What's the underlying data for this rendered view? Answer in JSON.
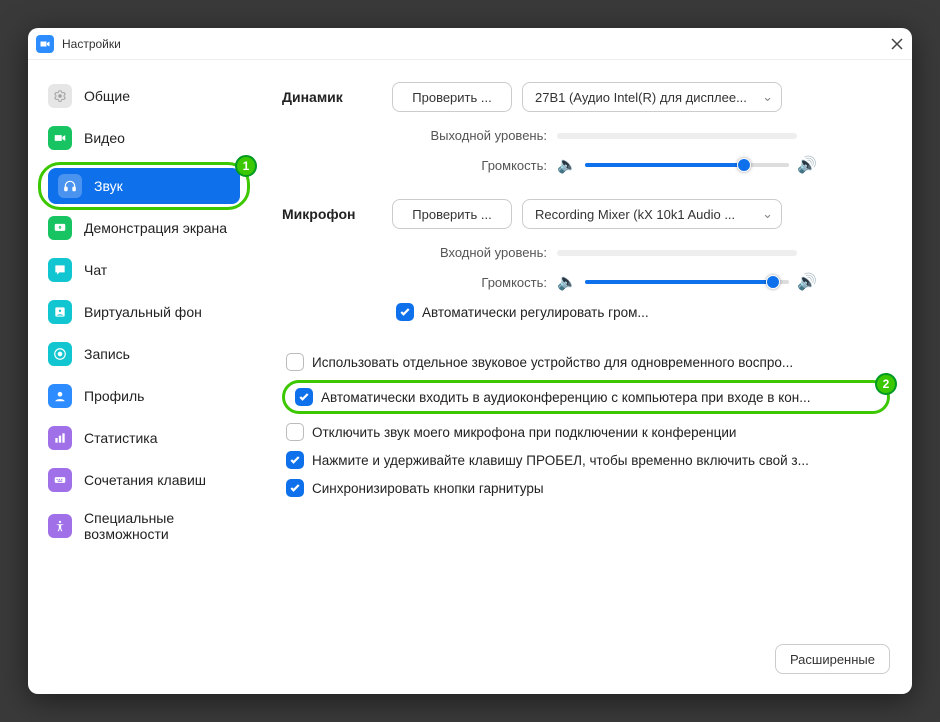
{
  "window": {
    "title": "Настройки",
    "close_label": "Close"
  },
  "sidebar": {
    "items": [
      {
        "label": "Общие",
        "icon": "gear",
        "color": "#c9c9c9"
      },
      {
        "label": "Видео",
        "icon": "video",
        "color": "#18C462"
      },
      {
        "label": "Звук",
        "icon": "audio",
        "color": "#ffffff",
        "active": true
      },
      {
        "label": "Демонстрация экрана",
        "icon": "screen",
        "color": "#18C462"
      },
      {
        "label": "Чат",
        "icon": "chat",
        "color": "#11C6D0"
      },
      {
        "label": "Виртуальный фон",
        "icon": "background",
        "color": "#11C6D0"
      },
      {
        "label": "Запись",
        "icon": "record",
        "color": "#11C6D0"
      },
      {
        "label": "Профиль",
        "icon": "profile",
        "color": "#2D8CFF"
      },
      {
        "label": "Статистика",
        "icon": "stats",
        "color": "#A070E8"
      },
      {
        "label": "Сочетания клавиш",
        "icon": "keyboard",
        "color": "#A070E8"
      },
      {
        "label": "Специальные",
        "label2": "возможности",
        "icon": "accessibility",
        "color": "#A070E8"
      }
    ]
  },
  "badges": {
    "sidebar": "1",
    "option": "2"
  },
  "speaker": {
    "section": "Динамик",
    "test_btn": "Проверить ...",
    "device": "27B1 (Аудио Intel(R) для дисплее...",
    "out_level_label": "Выходной уровень:",
    "volume_label": "Громкость:",
    "volume_pct": 78
  },
  "mic": {
    "section": "Микрофон",
    "test_btn": "Проверить ...",
    "device": "Recording Mixer (kX 10k1 Audio ...",
    "in_level_label": "Входной уровень:",
    "volume_label": "Громкость:",
    "volume_pct": 92,
    "auto_adjust_label": "Автоматически регулировать гром...",
    "auto_adjust_checked": true
  },
  "options": {
    "use_separate": {
      "label": "Использовать отдельное звуковое устройство для одновременного воспро...",
      "checked": false
    },
    "auto_join": {
      "label": "Автоматически входить в аудиоконференцию с компьютера при входе в кон...",
      "checked": true
    },
    "mute_on_join": {
      "label": "Отключить звук моего микрофона при подключении к конференции",
      "checked": false
    },
    "push_to_talk": {
      "label": "Нажмите и удерживайте клавишу ПРОБЕЛ, чтобы временно включить свой з...",
      "checked": true
    },
    "sync_headset": {
      "label": "Синхронизировать кнопки гарнитуры",
      "checked": true
    }
  },
  "footer": {
    "advanced_btn": "Расширенные"
  }
}
